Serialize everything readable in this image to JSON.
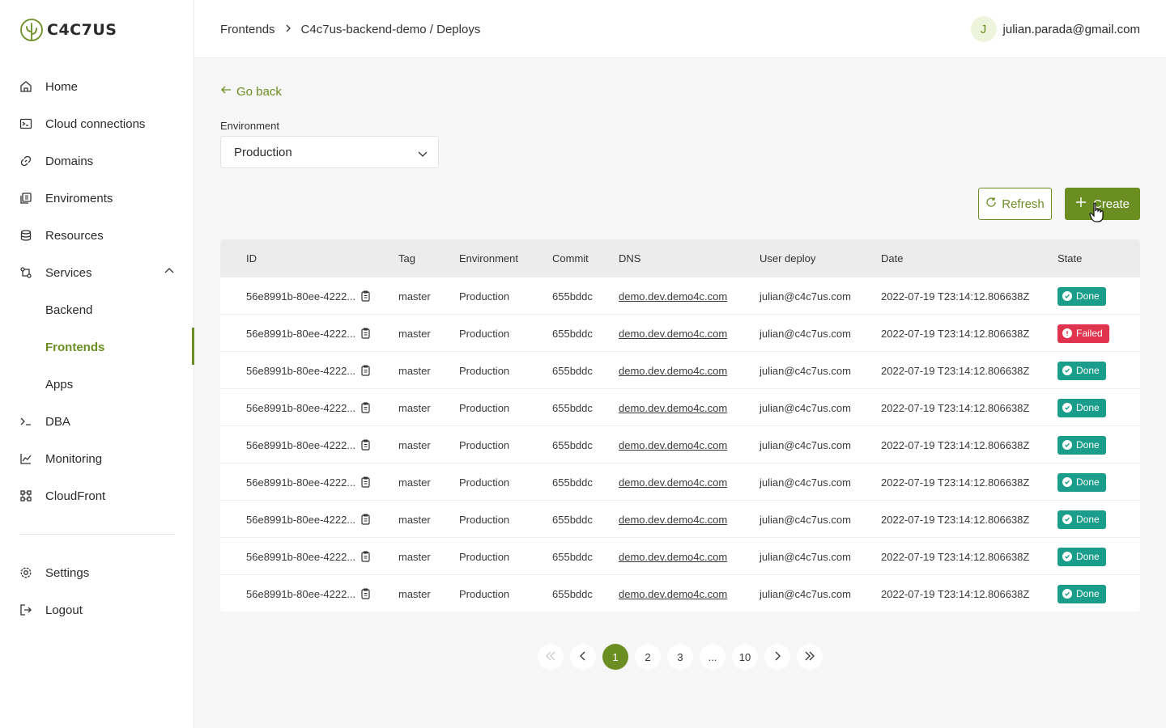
{
  "brand": {
    "name": "C4C7US",
    "accent": "#6b8e23"
  },
  "sidebar": {
    "items": [
      {
        "label": "Home",
        "icon": "home-icon"
      },
      {
        "label": "Cloud connections",
        "icon": "terminal-box-icon"
      },
      {
        "label": "Domains",
        "icon": "link-icon"
      },
      {
        "label": "Enviroments",
        "icon": "environments-icon"
      },
      {
        "label": "Resources",
        "icon": "database-icon"
      },
      {
        "label": "Services",
        "icon": "services-icon"
      },
      {
        "label": "DBA",
        "icon": "prompt-icon"
      },
      {
        "label": "Monitoring",
        "icon": "chart-line-icon"
      },
      {
        "label": "CloudFront",
        "icon": "cloudfront-icon"
      },
      {
        "label": "Settings",
        "icon": "gear-icon"
      },
      {
        "label": "Logout",
        "icon": "logout-icon"
      }
    ],
    "services_sub": [
      {
        "label": "Backend"
      },
      {
        "label": "Frontends"
      },
      {
        "label": "Apps"
      }
    ]
  },
  "header": {
    "breadcrumb": [
      "Frontends",
      "C4c7us-backend-demo / Deploys"
    ],
    "user_initial": "J",
    "user_email": "julian.parada@gmail.com"
  },
  "main": {
    "go_back": "Go back",
    "environment_label": "Environment",
    "environment_value": "Production",
    "refresh_label": "Refresh",
    "create_label": "Create"
  },
  "table": {
    "columns": [
      "ID",
      "Tag",
      "Environment",
      "Commit",
      "DNS",
      "User deploy",
      "Date",
      "State"
    ],
    "rows": [
      {
        "id": "56e8991b-80ee-4222...",
        "tag": "master",
        "env": "Production",
        "commit": "655bddc",
        "dns": "demo.dev.demo4c.com",
        "user": "julian@c4c7us.com",
        "date": "2022-07-19 T23:14:12.806638Z",
        "state": "Done"
      },
      {
        "id": "56e8991b-80ee-4222...",
        "tag": "master",
        "env": "Production",
        "commit": "655bddc",
        "dns": "demo.dev.demo4c.com",
        "user": "julian@c4c7us.com",
        "date": "2022-07-19 T23:14:12.806638Z",
        "state": "Failed"
      },
      {
        "id": "56e8991b-80ee-4222...",
        "tag": "master",
        "env": "Production",
        "commit": "655bddc",
        "dns": "demo.dev.demo4c.com",
        "user": "julian@c4c7us.com",
        "date": "2022-07-19 T23:14:12.806638Z",
        "state": "Done"
      },
      {
        "id": "56e8991b-80ee-4222...",
        "tag": "master",
        "env": "Production",
        "commit": "655bddc",
        "dns": "demo.dev.demo4c.com",
        "user": "julian@c4c7us.com",
        "date": "2022-07-19 T23:14:12.806638Z",
        "state": "Done"
      },
      {
        "id": "56e8991b-80ee-4222...",
        "tag": "master",
        "env": "Production",
        "commit": "655bddc",
        "dns": "demo.dev.demo4c.com",
        "user": "julian@c4c7us.com",
        "date": "2022-07-19 T23:14:12.806638Z",
        "state": "Done"
      },
      {
        "id": "56e8991b-80ee-4222...",
        "tag": "master",
        "env": "Production",
        "commit": "655bddc",
        "dns": "demo.dev.demo4c.com",
        "user": "julian@c4c7us.com",
        "date": "2022-07-19 T23:14:12.806638Z",
        "state": "Done"
      },
      {
        "id": "56e8991b-80ee-4222...",
        "tag": "master",
        "env": "Production",
        "commit": "655bddc",
        "dns": "demo.dev.demo4c.com",
        "user": "julian@c4c7us.com",
        "date": "2022-07-19 T23:14:12.806638Z",
        "state": "Done"
      },
      {
        "id": "56e8991b-80ee-4222...",
        "tag": "master",
        "env": "Production",
        "commit": "655bddc",
        "dns": "demo.dev.demo4c.com",
        "user": "julian@c4c7us.com",
        "date": "2022-07-19 T23:14:12.806638Z",
        "state": "Done"
      },
      {
        "id": "56e8991b-80ee-4222...",
        "tag": "master",
        "env": "Production",
        "commit": "655bddc",
        "dns": "demo.dev.demo4c.com",
        "user": "julian@c4c7us.com",
        "date": "2022-07-19 T23:14:12.806638Z",
        "state": "Done"
      }
    ]
  },
  "pagination": {
    "pages": [
      "1",
      "2",
      "3",
      "...",
      "10"
    ],
    "current": "1"
  },
  "colors": {
    "done": "#1a9d8a",
    "failed": "#e0334d"
  }
}
